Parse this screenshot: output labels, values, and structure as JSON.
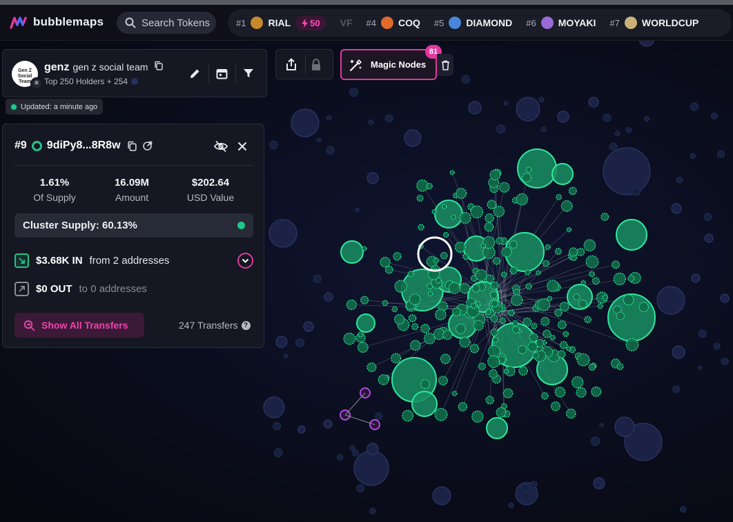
{
  "app": {
    "name": "bubblemaps"
  },
  "search": {
    "placeholder": "Search Tokens"
  },
  "trending": [
    {
      "rank": "#1",
      "name": "RIAL",
      "boost": "50",
      "color": "#c68a2a"
    },
    {
      "rank": "",
      "name": "VF",
      "faded": true
    },
    {
      "rank": "#4",
      "name": "COQ",
      "color": "#e06a2a"
    },
    {
      "rank": "#5",
      "name": "DIAMOND",
      "color": "#4a86d8"
    },
    {
      "rank": "#6",
      "name": "MOYAKI",
      "color": "#9a6bd8"
    },
    {
      "rank": "#7",
      "name": "WORLDCUP",
      "color": "#c9b27a"
    }
  ],
  "map": {
    "token_symbol": "genz",
    "token_name": "gen z social team",
    "avatar_text": "Gen Z Social Team",
    "subtitle": "Top 250 Holders + 254",
    "updated": "Updated: a minute ago"
  },
  "toolbar": {
    "magic_nodes_label": "Magic Nodes",
    "magic_nodes_count": "81"
  },
  "selected": {
    "rank": "#9",
    "address": "9diPy8...8R8w",
    "stats": [
      {
        "value": "1.61%",
        "label": "Of Supply"
      },
      {
        "value": "16.09M",
        "label": "Amount"
      },
      {
        "value": "$202.64",
        "label": "USD Value"
      }
    ],
    "cluster_supply": "Cluster Supply: 60.13%",
    "in_value": "$3.68K IN",
    "in_from": "from 2 addresses",
    "out_value": "$0 OUT",
    "out_to": "to 0 addresses",
    "show_transfers_label": "Show All Transfers",
    "transfers_count": "247 Transfers"
  },
  "colors": {
    "accent": "#e0389e",
    "green": "#22c58a",
    "bubble_dark": "#1b2245",
    "purple": "#b14de0"
  }
}
